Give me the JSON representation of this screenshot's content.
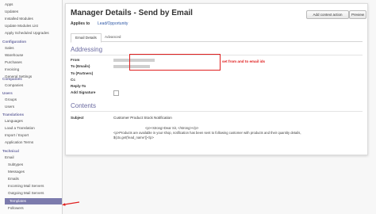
{
  "sidebar": {
    "items": [
      {
        "label": "Apps",
        "level": "sub"
      },
      {
        "label": "Updates",
        "level": "sub"
      },
      {
        "label": "Installed Modules",
        "level": "sub"
      },
      {
        "label": "Update Modules List",
        "level": "sub"
      },
      {
        "label": "Apply Scheduled Upgrades",
        "level": "sub"
      }
    ],
    "config_head": "Configuration",
    "config_items": [
      "Sales",
      "Warehouse",
      "Purchases",
      "Invoicing",
      "General Settings"
    ],
    "companies_head": "Companies",
    "companies_items": [
      "Companies"
    ],
    "users_head": "Users",
    "users_items": [
      "Groups",
      "Users"
    ],
    "translations_head": "Translations",
    "translations_items": [
      "Languages",
      "Load a Translation",
      "Import / Export",
      "Application Terms"
    ],
    "technical_head": "Technical",
    "email_group": "Email",
    "email_items": [
      "Subtypes",
      "Messages",
      "Emails",
      "Incoming Mail Servers",
      "Outgoing Mail Servers",
      "Templates",
      "Followers"
    ],
    "active_item": "Templates"
  },
  "form": {
    "title": "Manager Details - Send by Email",
    "applies_label": "Applies to",
    "applies_value": "Lead/Opportunity",
    "add_context_btn": "Add context action",
    "preview_btn": "Preview",
    "tabs": [
      "Email Details",
      "Advanced"
    ],
    "addressing_head": "Addressing",
    "fields": [
      "From",
      "To (Emails)",
      "To (Partners)",
      "Cc",
      "Reply-To",
      "Add Signature"
    ],
    "annotation": "set from and to email ids",
    "contents_head": "Contents",
    "subject_label": "Subject",
    "subject_value": "Customer Product Stock Notification",
    "body_lines": [
      "<p><strong>Dear Sir, </strong></p>",
      "<p>Products are available in your shop, notification has been sent to following customer with products and their quantity details,",
      "${ctx.get('lead_name')}</p>"
    ]
  }
}
